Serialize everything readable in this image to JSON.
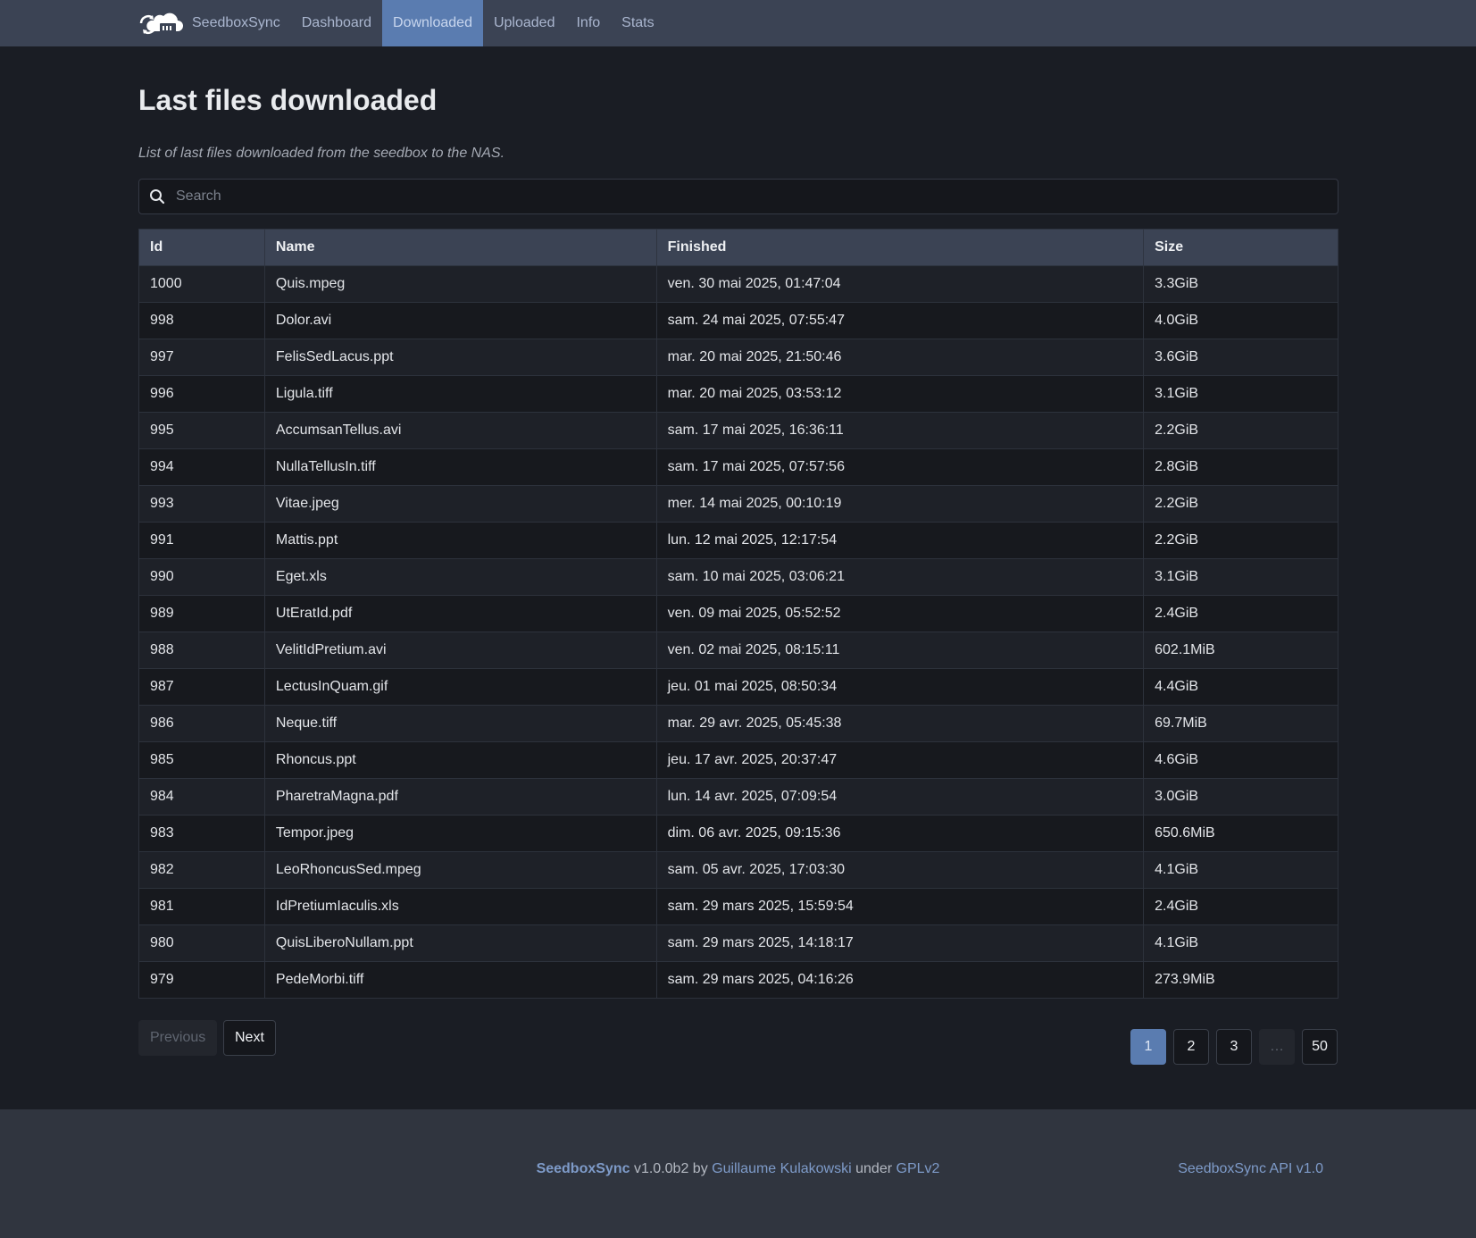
{
  "navbar": {
    "brand": "SeedboxSync",
    "brand_icon": "cloud-sync-logo-icon",
    "links": [
      {
        "label": "Dashboard",
        "active": false
      },
      {
        "label": "Downloaded",
        "active": true
      },
      {
        "label": "Uploaded",
        "active": false
      },
      {
        "label": "Info",
        "active": false
      },
      {
        "label": "Stats",
        "active": false
      }
    ]
  },
  "page": {
    "title": "Last files downloaded",
    "subtitle": "List of last files downloaded from the seedbox to the NAS."
  },
  "search": {
    "placeholder": "Search",
    "value": "",
    "icon": "search-icon"
  },
  "table": {
    "headers": [
      "Id",
      "Name",
      "Finished",
      "Size"
    ],
    "rows": [
      [
        "1000",
        "Quis.mpeg",
        "ven. 30 mai 2025, 01:47:04",
        "3.3GiB"
      ],
      [
        "998",
        "Dolor.avi",
        "sam. 24 mai 2025, 07:55:47",
        "4.0GiB"
      ],
      [
        "997",
        "FelisSedLacus.ppt",
        "mar. 20 mai 2025, 21:50:46",
        "3.6GiB"
      ],
      [
        "996",
        "Ligula.tiff",
        "mar. 20 mai 2025, 03:53:12",
        "3.1GiB"
      ],
      [
        "995",
        "AccumsanTellus.avi",
        "sam. 17 mai 2025, 16:36:11",
        "2.2GiB"
      ],
      [
        "994",
        "NullaTellusIn.tiff",
        "sam. 17 mai 2025, 07:57:56",
        "2.8GiB"
      ],
      [
        "993",
        "Vitae.jpeg",
        "mer. 14 mai 2025, 00:10:19",
        "2.2GiB"
      ],
      [
        "991",
        "Mattis.ppt",
        "lun. 12 mai 2025, 12:17:54",
        "2.2GiB"
      ],
      [
        "990",
        "Eget.xls",
        "sam. 10 mai 2025, 03:06:21",
        "3.1GiB"
      ],
      [
        "989",
        "UtEratId.pdf",
        "ven. 09 mai 2025, 05:52:52",
        "2.4GiB"
      ],
      [
        "988",
        "VelitIdPretium.avi",
        "ven. 02 mai 2025, 08:15:11",
        "602.1MiB"
      ],
      [
        "987",
        "LectusInQuam.gif",
        "jeu. 01 mai 2025, 08:50:34",
        "4.4GiB"
      ],
      [
        "986",
        "Neque.tiff",
        "mar. 29 avr. 2025, 05:45:38",
        "69.7MiB"
      ],
      [
        "985",
        "Rhoncus.ppt",
        "jeu. 17 avr. 2025, 20:37:47",
        "4.6GiB"
      ],
      [
        "984",
        "PharetraMagna.pdf",
        "lun. 14 avr. 2025, 07:09:54",
        "3.0GiB"
      ],
      [
        "983",
        "Tempor.jpeg",
        "dim. 06 avr. 2025, 09:15:36",
        "650.6MiB"
      ],
      [
        "982",
        "LeoRhoncusSed.mpeg",
        "sam. 05 avr. 2025, 17:03:30",
        "4.1GiB"
      ],
      [
        "981",
        "IdPretiumIaculis.xls",
        "sam. 29 mars 2025, 15:59:54",
        "2.4GiB"
      ],
      [
        "980",
        "QuisLiberoNullam.ppt",
        "sam. 29 mars 2025, 14:18:17",
        "4.1GiB"
      ],
      [
        "979",
        "PedeMorbi.tiff",
        "sam. 29 mars 2025, 04:16:26",
        "273.9MiB"
      ]
    ]
  },
  "pager": {
    "previous_label": "Previous",
    "next_label": "Next",
    "pages": [
      "1",
      "2",
      "3",
      "…",
      "50"
    ],
    "current_page": "1"
  },
  "footer": {
    "brand": "SeedboxSync",
    "version": "v1.0.0b2",
    "by_text": "by",
    "author": "Guillaume Kulakowski",
    "under_text": "under",
    "license": "GPLv2",
    "api_label": "SeedboxSync API v1.0"
  },
  "colors": {
    "navbar_bg": "#3b4354",
    "active_accent": "#5a7cb0",
    "page_bg": "#1a1d24",
    "link": "#7e9bc9"
  }
}
